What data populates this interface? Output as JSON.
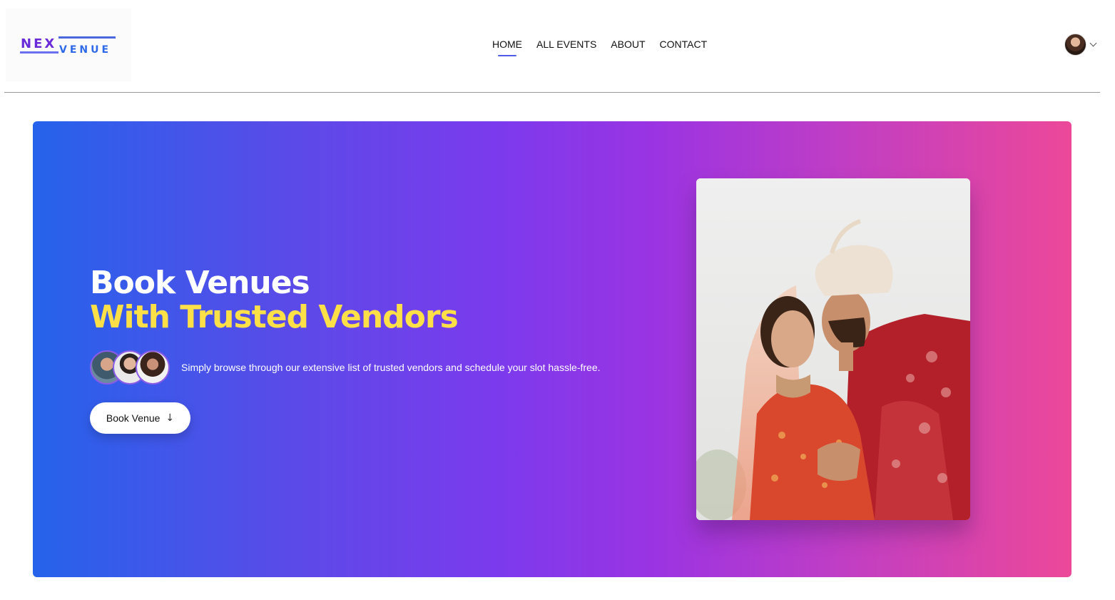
{
  "brand": {
    "nex": "NEX",
    "venue": "VENUE"
  },
  "nav": {
    "items": [
      {
        "label": "HOME",
        "active": true
      },
      {
        "label": "ALL EVENTS",
        "active": false
      },
      {
        "label": "ABOUT",
        "active": false
      },
      {
        "label": "CONTACT",
        "active": false
      }
    ]
  },
  "user_menu": {
    "avatar_icon": "user-avatar",
    "chevron_icon": "chevron-down-icon"
  },
  "hero": {
    "title_line1": "Book Venues",
    "title_line2": "With Trusted Vendors",
    "subtitle": "Simply browse through our extensive list of trusted vendors and schedule your slot hassle-free.",
    "cta_label": "Book Venue",
    "cta_icon": "arrow-down-icon",
    "gradient": [
      "#2563eb",
      "#7c3aed",
      "#ec4899"
    ],
    "title_accent_color": "#fde047"
  }
}
